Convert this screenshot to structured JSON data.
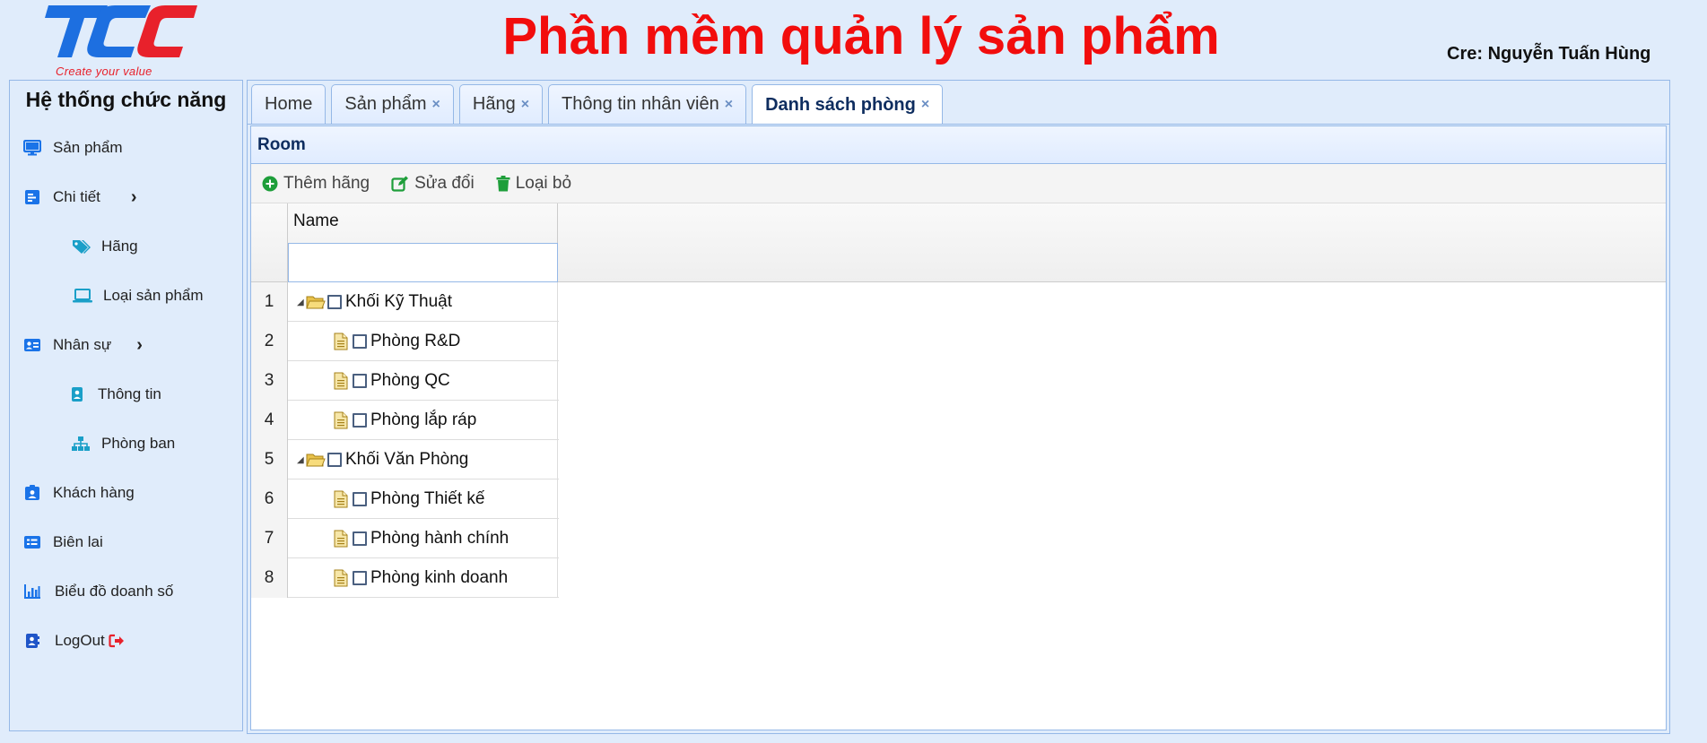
{
  "header": {
    "logo_text": "TCC",
    "logo_tagline": "Create your value",
    "title": "Phần mềm quản lý sản phẩm",
    "credit": "Cre: Nguyễn Tuấn Hùng"
  },
  "colors": {
    "title_red": "#f20d0d",
    "background": "#e0ecfb",
    "border": "#95b8e7",
    "icon_blue": "#1a73e8",
    "icon_teal": "#1a9fc8",
    "add_green": "#1e9e3a"
  },
  "sidebar": {
    "title": "Hệ thống chức năng",
    "items": [
      {
        "label": "Sản phẩm",
        "icon": "monitor-icon"
      },
      {
        "label": "Chi tiết",
        "icon": "detail-list-icon",
        "has_submenu": true
      },
      {
        "label": "Hãng",
        "icon": "tags-icon",
        "child": true
      },
      {
        "label": "Loại sản phẩm",
        "icon": "laptop-icon",
        "child": true
      },
      {
        "label": "Nhân sự",
        "icon": "id-card-icon",
        "has_submenu": true
      },
      {
        "label": "Thông tin",
        "icon": "id-badge-icon",
        "child": true
      },
      {
        "label": "Phòng ban",
        "icon": "sitemap-icon",
        "child": true
      },
      {
        "label": "Khách hàng",
        "icon": "contact-card-icon"
      },
      {
        "label": "Biên lai",
        "icon": "receipt-icon"
      },
      {
        "label": "Biểu đồ doanh số",
        "icon": "bar-chart-icon"
      },
      {
        "label": "LogOut",
        "icon": "address-book-icon"
      }
    ]
  },
  "tabs": [
    {
      "label": "Home",
      "closable": false,
      "active": false
    },
    {
      "label": "Sản phẩm",
      "closable": true,
      "active": false
    },
    {
      "label": "Hãng",
      "closable": true,
      "active": false
    },
    {
      "label": "Thông tin nhân viên",
      "closable": true,
      "active": false
    },
    {
      "label": "Danh sách phòng",
      "closable": true,
      "active": true
    }
  ],
  "tab_close_glyph": "×",
  "panel": {
    "title": "Room",
    "toolbar": {
      "add_label": "Thêm hãng",
      "edit_label": "Sửa đổi",
      "delete_label": "Loại bỏ"
    },
    "grid": {
      "column_name": "Name",
      "filter_value": "",
      "rows": [
        {
          "num": "1",
          "name": "Khối Kỹ Thuật",
          "type": "folder",
          "expanded": true
        },
        {
          "num": "2",
          "name": "Phòng R&D",
          "type": "file"
        },
        {
          "num": "3",
          "name": "Phòng QC",
          "type": "file"
        },
        {
          "num": "4",
          "name": "Phòng lắp ráp",
          "type": "file"
        },
        {
          "num": "5",
          "name": "Khối Văn Phòng",
          "type": "folder",
          "expanded": true
        },
        {
          "num": "6",
          "name": "Phòng Thiết kế",
          "type": "file"
        },
        {
          "num": "7",
          "name": "Phòng hành chính",
          "type": "file"
        },
        {
          "num": "8",
          "name": "Phòng kinh doanh",
          "type": "file"
        }
      ]
    }
  }
}
